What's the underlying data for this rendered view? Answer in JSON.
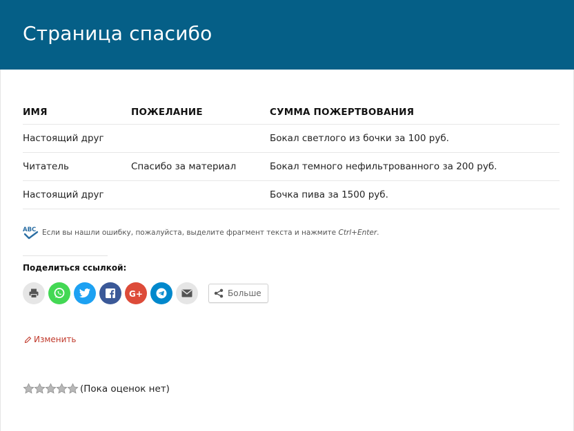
{
  "page": {
    "title": "Страница спасибо"
  },
  "table": {
    "headers": [
      "ИМЯ",
      "ПОЖЕЛАНИЕ",
      "СУММА ПОЖЕРТВОВАНИЯ"
    ],
    "rows": [
      [
        "Настоящий друг",
        "",
        "Бокал светлого из бочки за 100 руб."
      ],
      [
        "Читатель",
        "Спасибо за материал",
        "Бокал темного нефильтрованного за 200 руб."
      ],
      [
        "Настоящий друг",
        "",
        "Бочка пива за 1500 руб."
      ]
    ]
  },
  "spellcheck": {
    "icon": "abc-spellcheck-icon",
    "text": "Если вы нашли ошибку, пожалуйста, выделите фрагмент текста и нажмите ",
    "shortcut": "Ctrl+Enter",
    "suffix": "."
  },
  "share": {
    "title": "Поделиться ссылкой:",
    "buttons": [
      {
        "name": "print",
        "icon": "printer-icon",
        "color": "#e6e6e6"
      },
      {
        "name": "whatsapp",
        "icon": "whatsapp-icon",
        "color": "#43d854"
      },
      {
        "name": "twitter",
        "icon": "twitter-icon",
        "color": "#1da1f2"
      },
      {
        "name": "facebook",
        "icon": "facebook-icon",
        "color": "#3b5998"
      },
      {
        "name": "google-plus",
        "icon": "google-plus-icon",
        "color": "#dd4b39"
      },
      {
        "name": "telegram",
        "icon": "telegram-icon",
        "color": "#0088cc"
      },
      {
        "name": "email",
        "icon": "envelope-icon",
        "color": "#e6e6e6"
      }
    ],
    "more_label": "Больше"
  },
  "edit": {
    "label": "Изменить",
    "color": "#c0392b"
  },
  "rating": {
    "stars_filled": 0,
    "stars_total": 5,
    "text": "(Пока оценок нет)"
  },
  "colors": {
    "header_bg": "#055f87"
  }
}
